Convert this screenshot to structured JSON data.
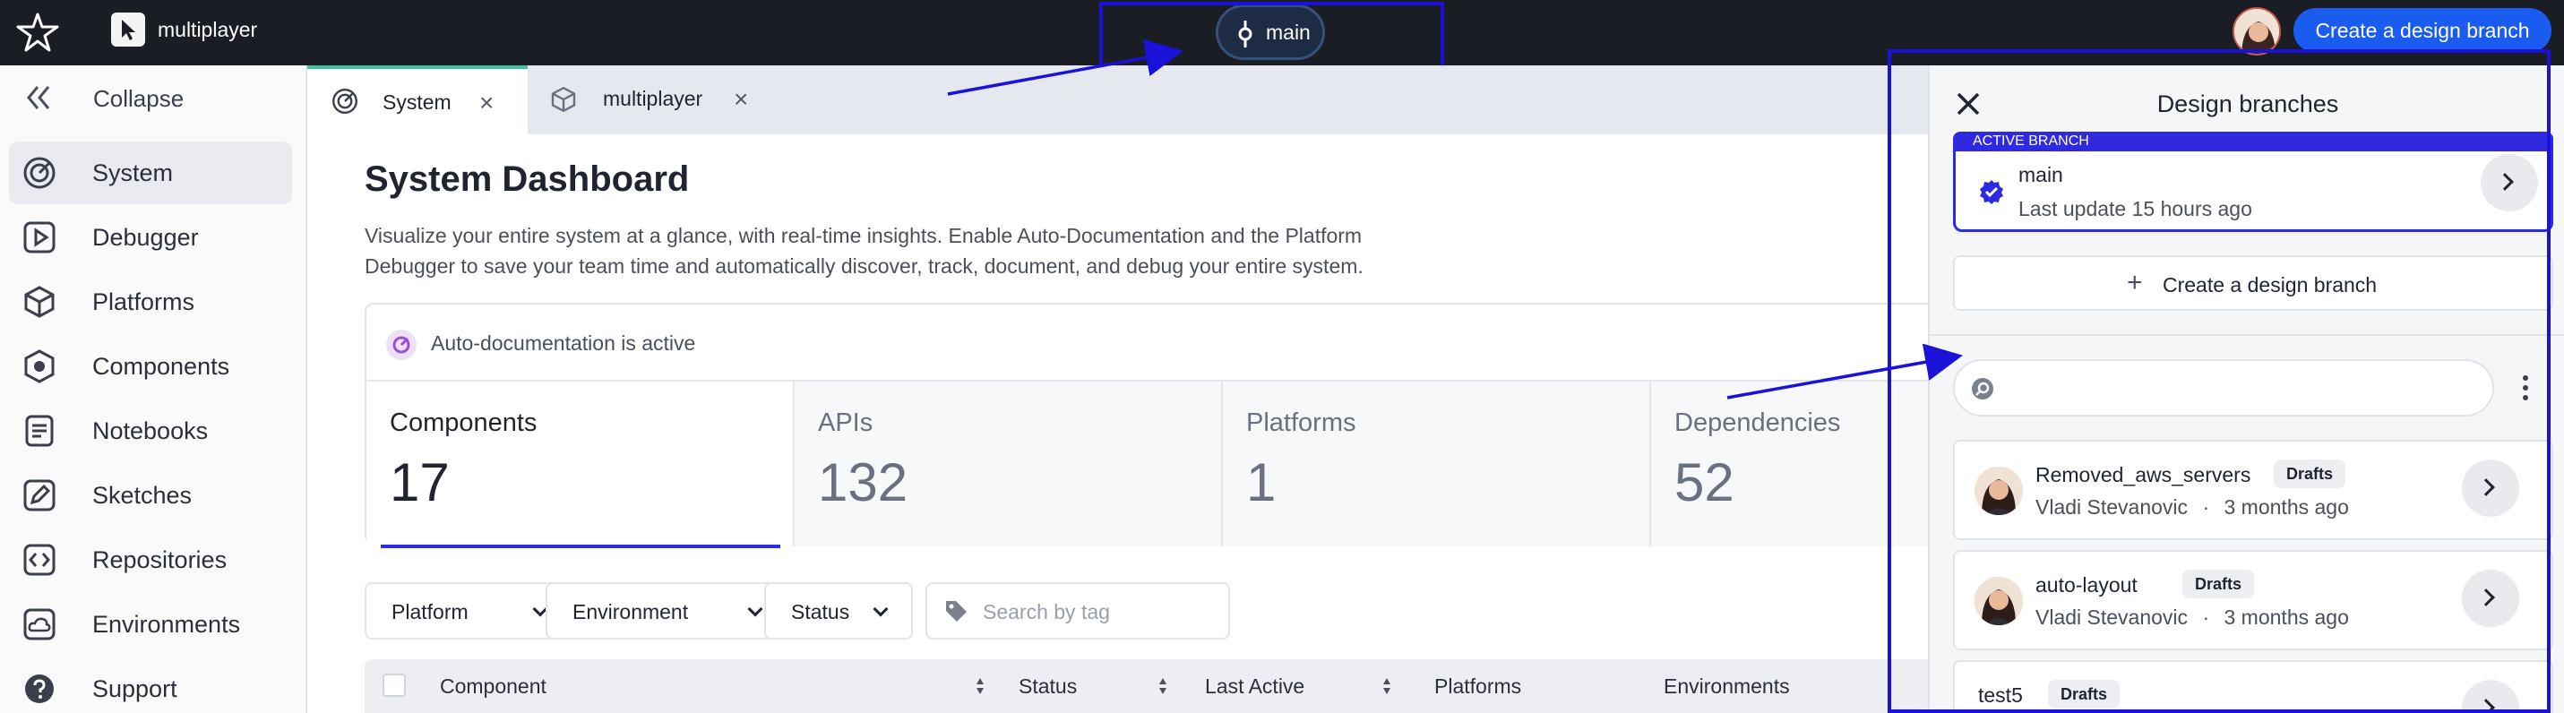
{
  "topbar": {
    "workspace_name": "multiplayer",
    "branch": "main",
    "create_button": "Create a design branch"
  },
  "sidebar": {
    "collapse_label": "Collapse",
    "items": [
      {
        "label": "System",
        "icon": "system-gauge-icon",
        "active": true
      },
      {
        "label": "Debugger",
        "icon": "play-square-icon",
        "active": false
      },
      {
        "label": "Platforms",
        "icon": "cube-icon",
        "active": false
      },
      {
        "label": "Components",
        "icon": "hexagon-icon",
        "active": false
      },
      {
        "label": "Notebooks",
        "icon": "notebook-icon",
        "active": false
      },
      {
        "label": "Sketches",
        "icon": "pencil-square-icon",
        "active": false
      },
      {
        "label": "Repositories",
        "icon": "code-brackets-icon",
        "active": false
      },
      {
        "label": "Environments",
        "icon": "cloud-icon",
        "active": false
      },
      {
        "label": "Support",
        "icon": "help-icon",
        "active": false
      }
    ]
  },
  "tabs": [
    {
      "label": "System",
      "active": true
    },
    {
      "label": "multiplayer",
      "active": false
    }
  ],
  "main": {
    "title": "System Dashboard",
    "description": "Visualize your entire system at a glance, with real-time insights. Enable Auto-Documentation and the Platform Debugger to save your team time and automatically discover, track, document, and debug your entire system.",
    "auto_doc": "Auto-documentation is active",
    "stats": [
      {
        "label": "Components",
        "value": "17",
        "active": true
      },
      {
        "label": "APIs",
        "value": "132",
        "active": false
      },
      {
        "label": "Platforms",
        "value": "1",
        "active": false
      },
      {
        "label": "Dependencies",
        "value": "52",
        "active": false
      }
    ],
    "filters": [
      "Platform",
      "Environment",
      "Status"
    ],
    "tag_search_placeholder": "Search by tag",
    "columns": [
      "Component",
      "Status",
      "Last Active",
      "Platforms",
      "Environments"
    ]
  },
  "drawer": {
    "title": "Design branches",
    "active_tag": "ACTIVE BRANCH",
    "active_branch": {
      "name": "main",
      "updated": "Last update 15 hours ago"
    },
    "create_label": "Create a design branch",
    "search_value": "",
    "branches": [
      {
        "name": "Removed_aws_servers",
        "badge": "Drafts",
        "author": "Vladi Stevanovic",
        "time": "3 months ago"
      },
      {
        "name": "auto-layout",
        "badge": "Drafts",
        "author": "Vladi Stevanovic",
        "time": "3 months ago"
      },
      {
        "name": "test5",
        "badge": "Drafts",
        "author": "",
        "time": ""
      }
    ]
  },
  "colors": {
    "accent": "#1a5cf0",
    "highlight": "#1a12d9",
    "active_border": "#2f2ae0",
    "tab_active_top": "#3fc3a1",
    "topbar_bg": "#1b1d24"
  }
}
